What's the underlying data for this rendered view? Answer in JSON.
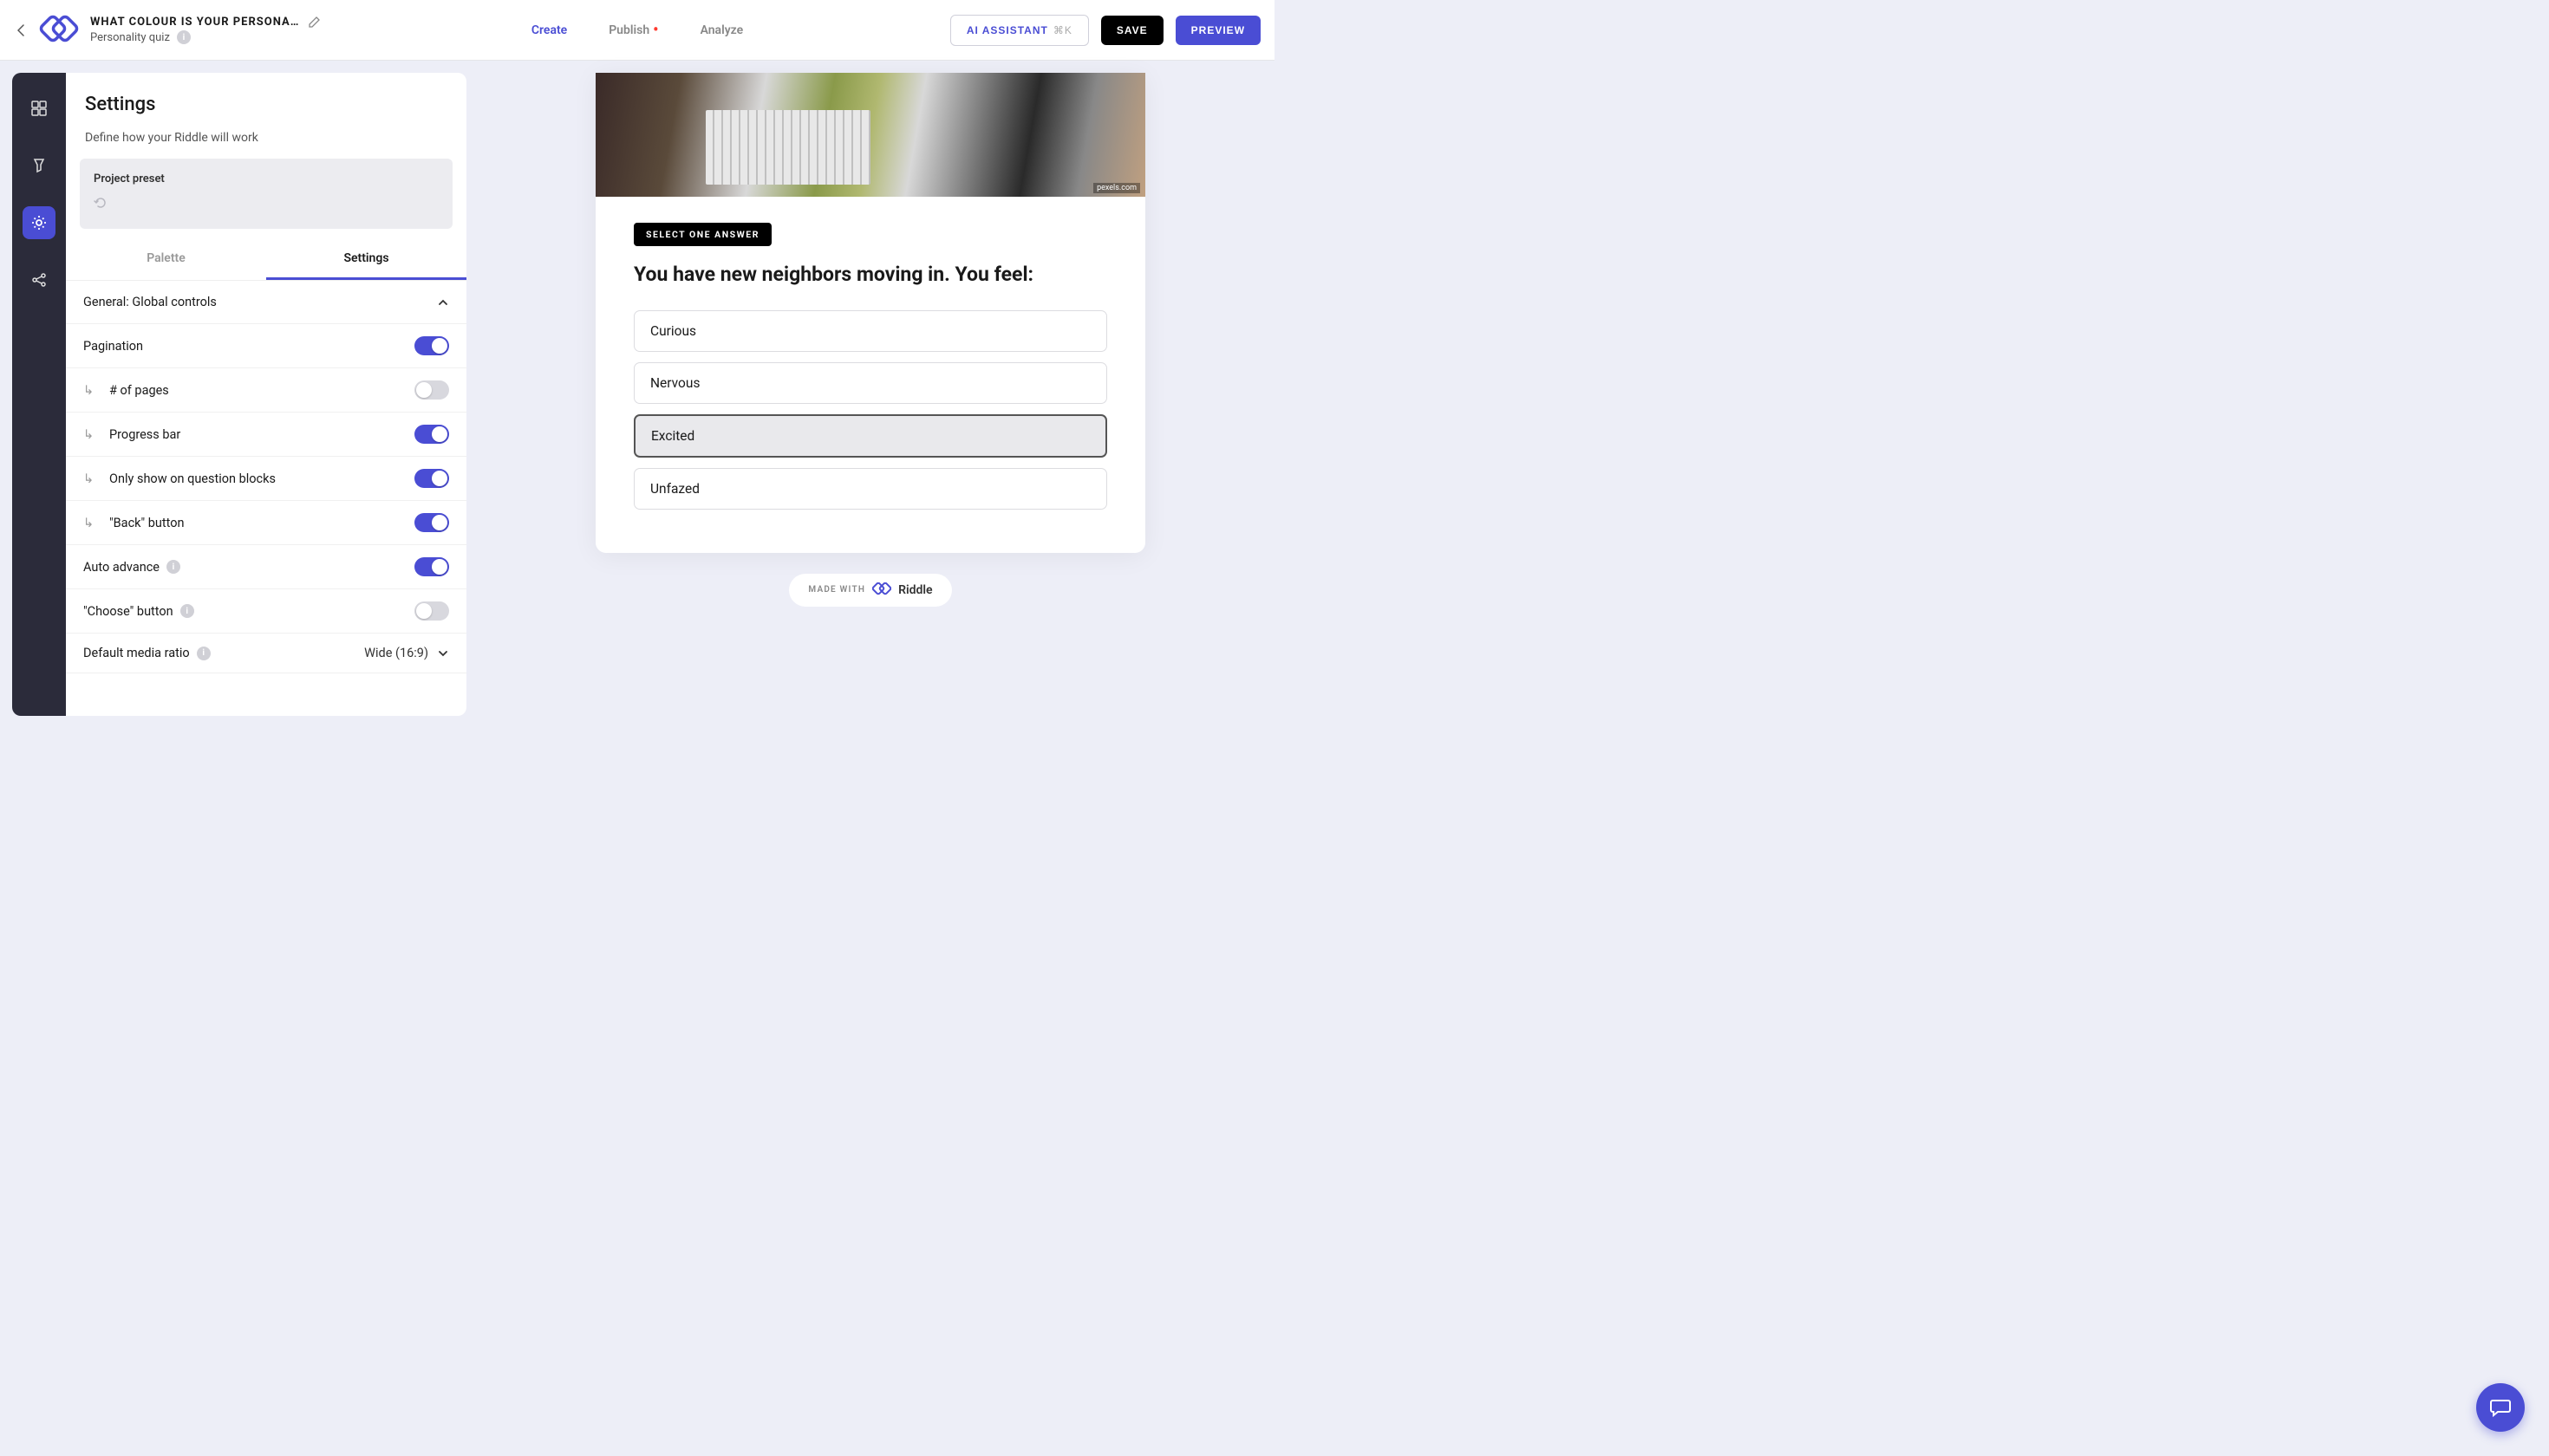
{
  "colors": {
    "accent": "#4a4dd4",
    "dark": "#000000",
    "railBg": "#2b2b3a"
  },
  "header": {
    "project_title": "WHAT COLOUR IS YOUR PERSONA…",
    "project_type": "Personality quiz",
    "nav": {
      "create": "Create",
      "publish": "Publish",
      "analyze": "Analyze"
    },
    "buttons": {
      "ai": "AI ASSISTANT",
      "ai_kbd": "⌘K",
      "save": "SAVE",
      "preview": "PREVIEW"
    }
  },
  "rail": {
    "items": [
      "blocks-icon",
      "design-icon",
      "settings-icon",
      "share-icon"
    ],
    "activeIndex": 2
  },
  "panel": {
    "title": "Settings",
    "desc": "Define how your Riddle will work",
    "preset_label": "Project preset",
    "tabs": {
      "palette": "Palette",
      "settings": "Settings",
      "active": "settings"
    },
    "section_header": "General: Global controls",
    "rows": {
      "pagination": "Pagination",
      "num_pages": "# of pages",
      "progress_bar": "Progress bar",
      "only_question": "Only show on question blocks",
      "back_button": "\"Back\" button",
      "auto_advance": "Auto advance",
      "choose_button": "\"Choose\" button",
      "default_ratio": "Default media ratio"
    },
    "toggles": {
      "pagination": true,
      "num_pages": false,
      "progress_bar": true,
      "only_question": true,
      "back_button": true,
      "auto_advance": true,
      "choose_button": false
    },
    "ratio_value": "Wide (16:9)"
  },
  "preview": {
    "img_credit": "pexels.com",
    "badge": "SELECT ONE ANSWER",
    "question": "You have new neighbors moving in. You feel:",
    "answers": [
      "Curious",
      "Nervous",
      "Excited",
      "Unfazed"
    ],
    "selectedIndex": 2,
    "made_with": "MADE WITH",
    "brand": "Riddle"
  }
}
